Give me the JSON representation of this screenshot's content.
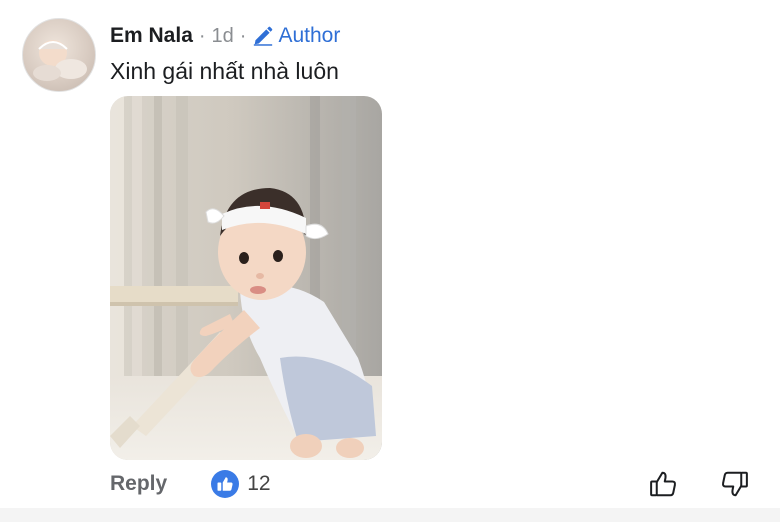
{
  "comment": {
    "author": "Em Nala",
    "separator": "·",
    "time": "1d",
    "badge": "Author",
    "text": "Xinh gái nhất nhà luôn"
  },
  "actions": {
    "reply_label": "Reply",
    "reaction_count": "12"
  },
  "icons": {
    "like_badge": "thumbs-up-icon",
    "upvote": "thumbs-up-outline-icon",
    "downvote": "thumbs-down-outline-icon",
    "author_badge": "pencil-icon"
  },
  "colors": {
    "accent": "#2f6fd6",
    "like_badge_bg": "#3a7be6",
    "text_primary": "#1c1e21",
    "text_secondary": "#65676b"
  }
}
